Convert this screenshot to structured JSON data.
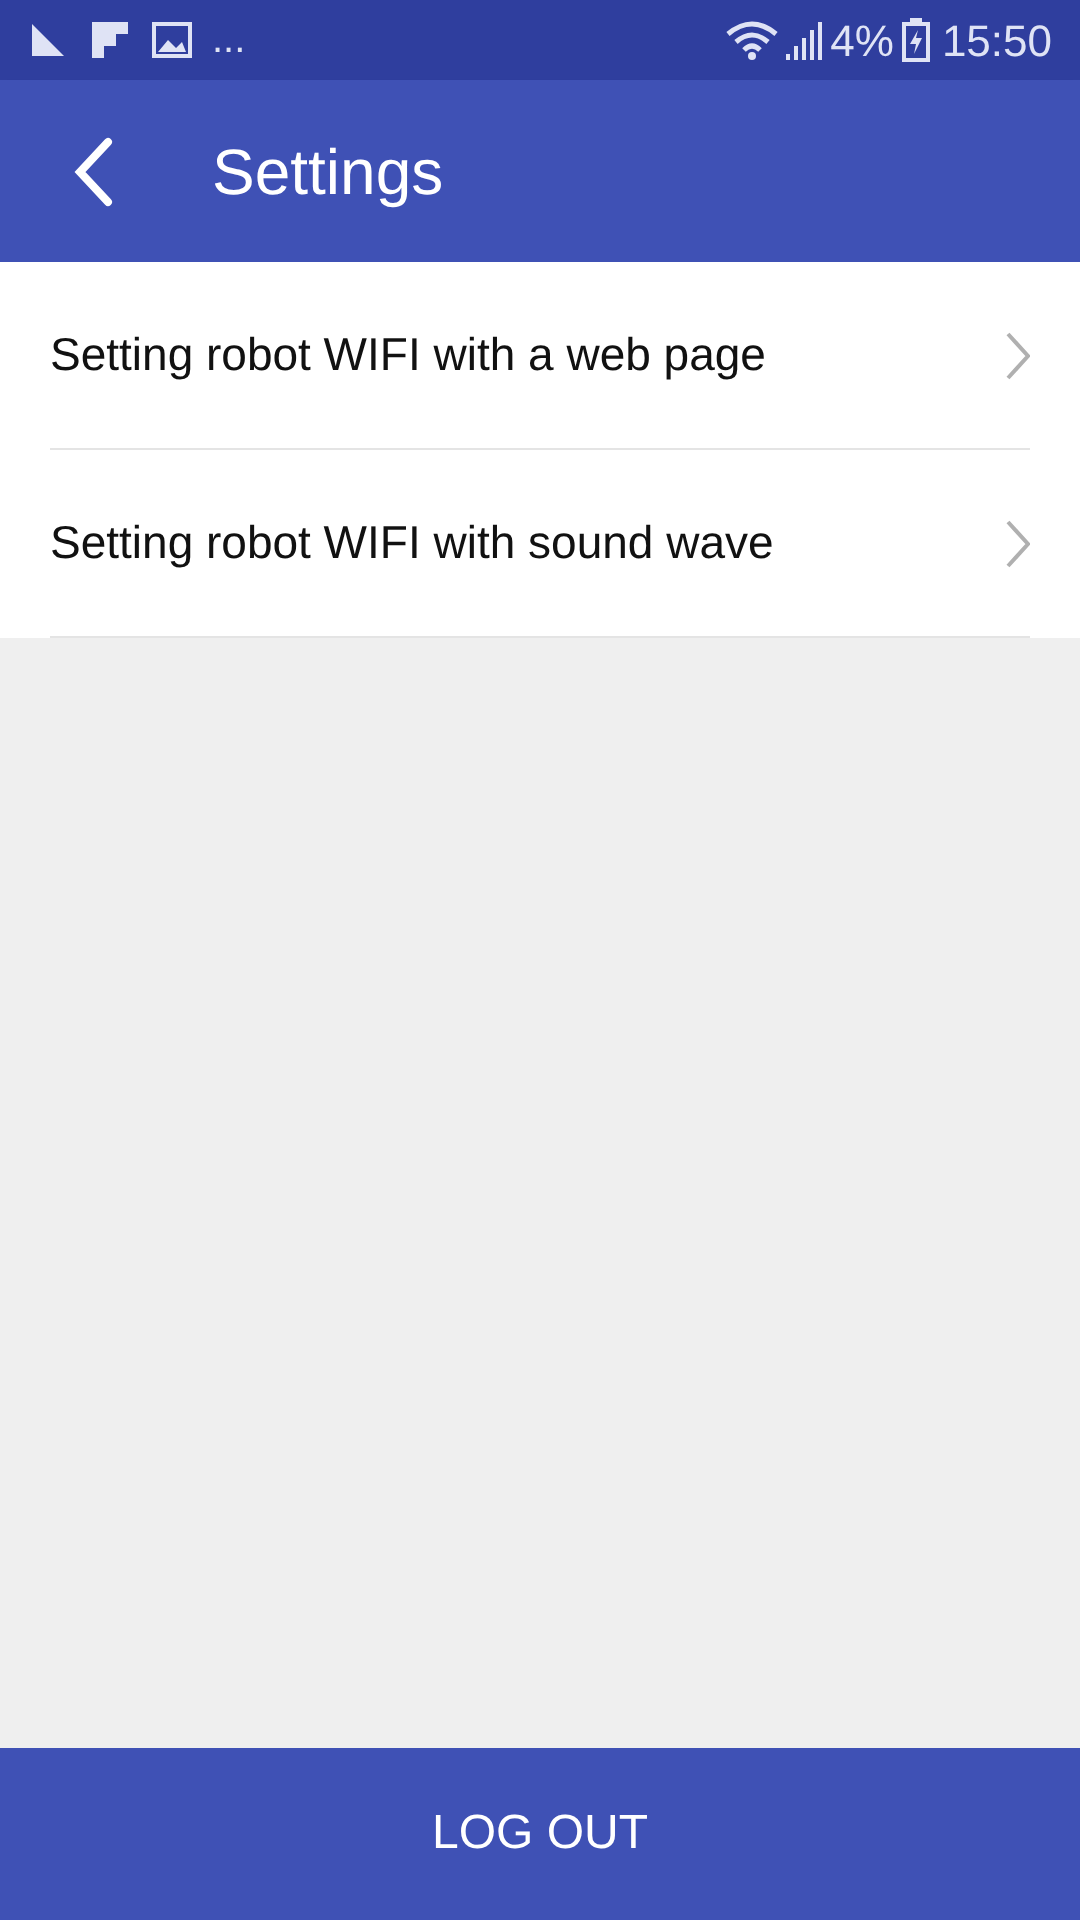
{
  "status_bar": {
    "more": "...",
    "battery": "4%",
    "time": "15:50"
  },
  "header": {
    "title": "Settings"
  },
  "items": [
    {
      "label": "Setting robot WIFI with a web page"
    },
    {
      "label": "Setting robot WIFI with sound wave"
    }
  ],
  "logout_button": "LOG OUT"
}
